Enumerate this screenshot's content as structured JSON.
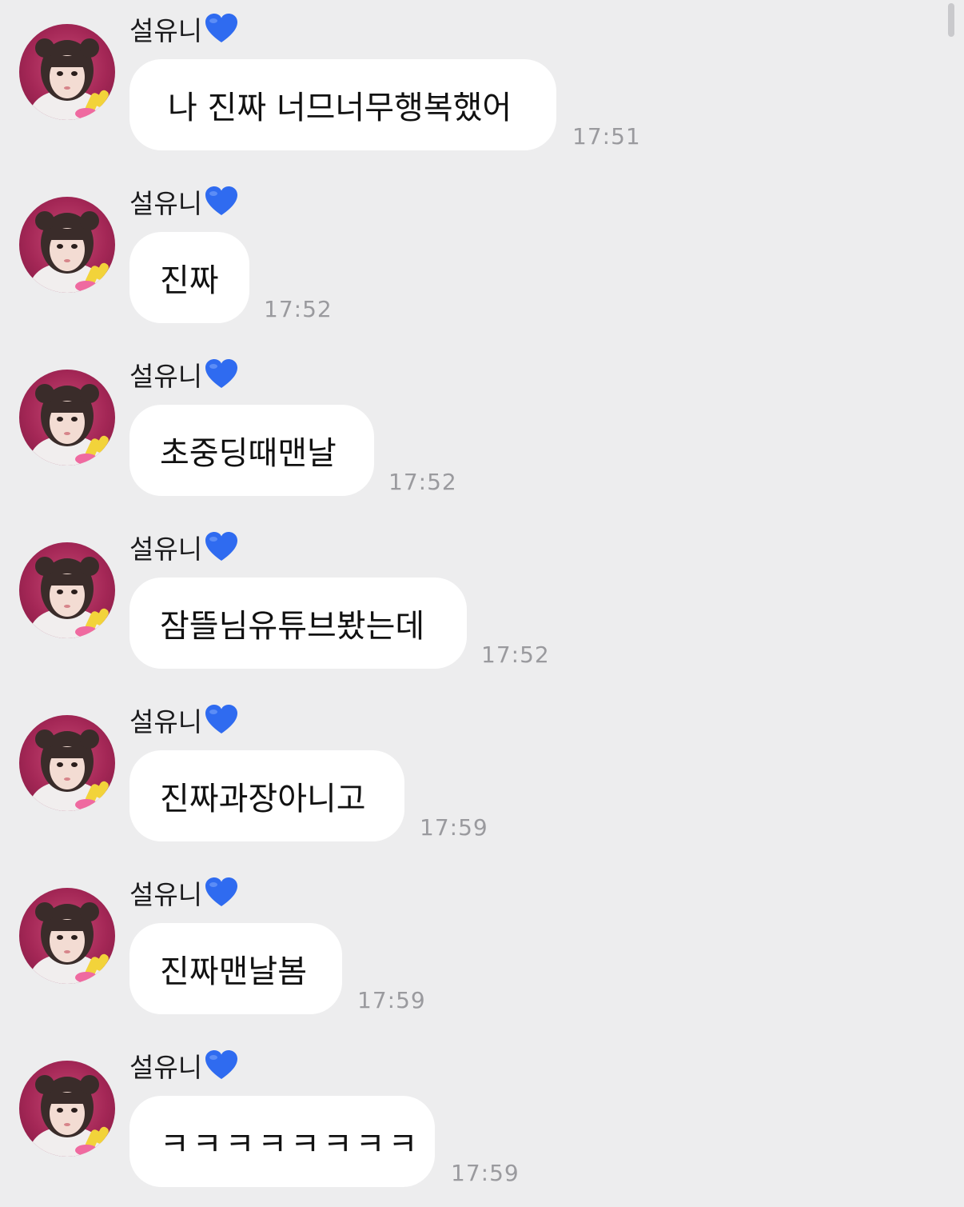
{
  "messages": [
    {
      "sender": "설유니",
      "text": "나 진짜 너므너무행복했어",
      "time": "17:51"
    },
    {
      "sender": "설유니",
      "text": "진짜",
      "time": "17:52"
    },
    {
      "sender": "설유니",
      "text": "초중딩때맨날",
      "time": "17:52"
    },
    {
      "sender": "설유니",
      "text": "잠뜰님유튜브봤는데",
      "time": "17:52"
    },
    {
      "sender": "설유니",
      "text": "진짜과장아니고",
      "time": "17:59"
    },
    {
      "sender": "설유니",
      "text": "진짜맨날봄",
      "time": "17:59"
    },
    {
      "sender": "설유니",
      "text": "ㅋㅋㅋㅋㅋㅋㅋㅋ",
      "time": "17:59"
    }
  ],
  "icons": {
    "sender_badge": "blue-heart-icon",
    "avatar": "profile-photo"
  },
  "colors": {
    "background": "#ededee",
    "bubble": "#ffffff",
    "heart": "#2f6bf0",
    "timestamp": "#9a9a9e"
  }
}
